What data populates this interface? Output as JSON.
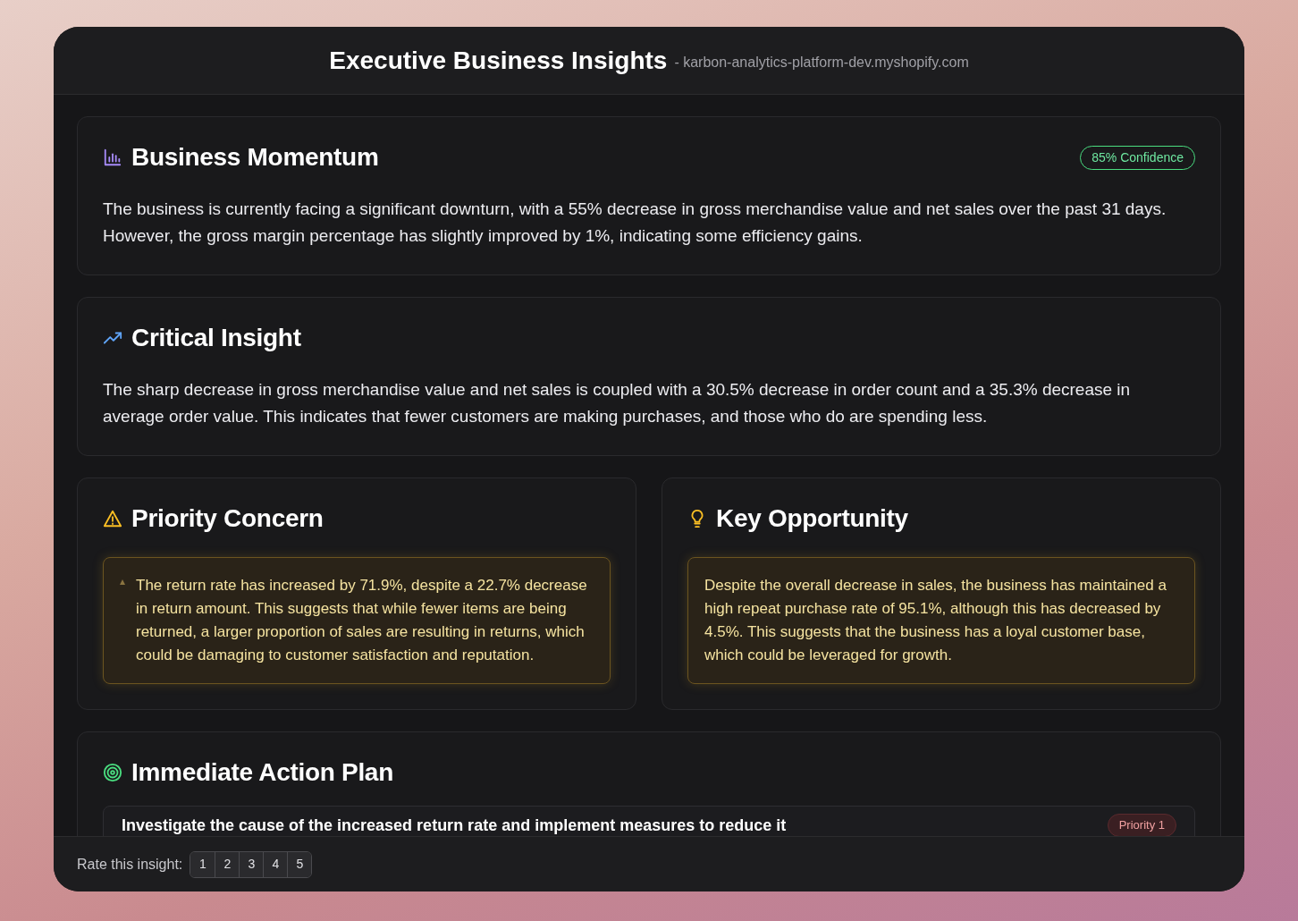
{
  "header": {
    "title": "Executive Business Insights",
    "subtitle": "- karbon-analytics-platform-dev.myshopify.com"
  },
  "sections": [
    {
      "kind": "summary",
      "title": "Business Momentum",
      "badge": "85% Confidence",
      "text": "The business is currently facing a significant downturn, with a 55% decrease in gross merchandise value and net sales over the past 31 days. However, the gross margin percentage has slightly improved by 1%, indicating some efficiency gains."
    },
    {
      "kind": "summary",
      "title": "Critical Insight",
      "text": "The sharp decrease in gross merchandise value and net sales is coupled with a 30.5% decrease in order count and a 35.3% decrease in average order value. This indicates that fewer customers are making purchases, and those who do are spending less."
    },
    {
      "kind": "pair",
      "panels": [
        {
          "title": "Priority Concern",
          "marker": true,
          "text": "The return rate has increased by 71.9%, despite a 22.7% decrease in return amount. This suggests that while fewer items are being returned, a larger proportion of sales are resulting in returns, which could be damaging to customer satisfaction and reputation."
        },
        {
          "title": "Key Opportunity",
          "marker": false,
          "text": "Despite the overall decrease in sales, the business has maintained a high repeat purchase rate of 95.1%, although this has decreased by 4.5%. This suggests that the business has a loyal customer base, which could be leveraged for growth."
        }
      ]
    },
    {
      "kind": "actions",
      "title": "Immediate Action Plan",
      "items": [
        {
          "text": "Investigate the cause of the increased return rate and implement measures to reduce it",
          "priority": "Priority 1"
        }
      ]
    }
  ],
  "rating": {
    "label": "Rate this insight:",
    "options": [
      "1",
      "2",
      "3",
      "4",
      "5"
    ]
  }
}
